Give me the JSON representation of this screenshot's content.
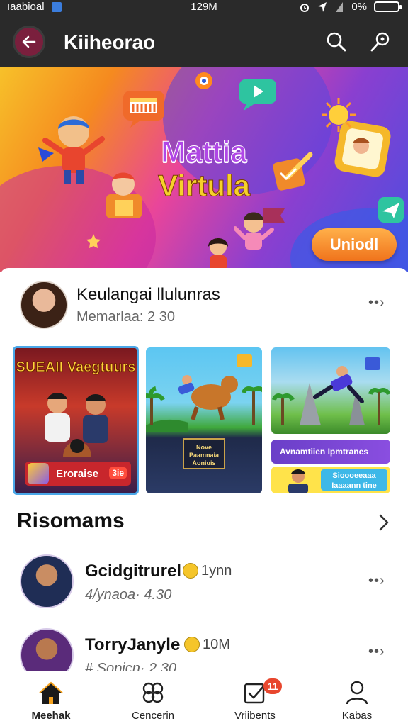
{
  "status_bar": {
    "carrier": "ıaabioal",
    "time": "129M",
    "battery": "0%",
    "battery_level": 0.0
  },
  "app_bar": {
    "title": "Kiiheorao"
  },
  "hero": {
    "title_line1": "Mattia",
    "title_line2": "Virtula",
    "cta_label": "Uniodl"
  },
  "profile": {
    "name": "Keulangai llulunras",
    "meta": "Memarlaa: 2 30",
    "more": "••›"
  },
  "media": {
    "featured_title": "SUEAII Vaegtuurs",
    "featured_footer": "Eroraise",
    "featured_count": "3ie",
    "tile_b_sign": "Nove Paamnaia Aoniuis",
    "tile_d_text": "Avnamtiien Ipmtranes",
    "tile_e_text": "Sioooeeaaa Iaaaann tine"
  },
  "section": {
    "title": "Risomams",
    "chevron": "›"
  },
  "list": [
    {
      "title": "Gcidgitrurel",
      "count": "1ynn",
      "meta": "4/ynaoa· 4.30",
      "more": "••›"
    },
    {
      "title": "TorryJanyle",
      "count": "10M",
      "meta": "# Sopicn· 2 30",
      "more": "••›"
    }
  ],
  "bottom_nav": [
    {
      "label": "Meehak",
      "icon": "home-icon",
      "active": true
    },
    {
      "label": "Cencerin",
      "icon": "share-icon",
      "active": false
    },
    {
      "label": "Vriibents",
      "icon": "checkbox-icon",
      "active": false,
      "badge": "11"
    },
    {
      "label": "Kabas",
      "icon": "person-icon",
      "active": false
    }
  ],
  "colors": {
    "app_bar": "#2a2a2a",
    "back_button": "#7a1f3d",
    "cta": "#f0731c",
    "badge": "#e8472e"
  }
}
